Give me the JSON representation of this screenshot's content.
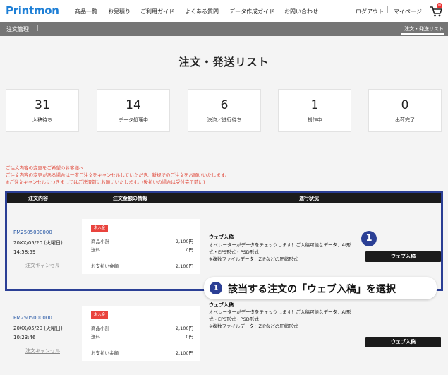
{
  "header": {
    "logo": "Printmon",
    "nav": [
      "商品一覧",
      "お見積り",
      "ご利用ガイド",
      "よくある質問",
      "データ作成ガイド",
      "お問い合わせ"
    ],
    "logout": "ログアウト",
    "mypage": "マイページ",
    "cart_count": "0"
  },
  "subbar": {
    "left": "注文管理",
    "right": "注文・発送リスト"
  },
  "page_title": "注文・発送リスト",
  "stats": [
    {
      "num": "31",
      "label": "入稿待ち"
    },
    {
      "num": "14",
      "label": "データ処理中"
    },
    {
      "num": "6",
      "label": "決済／進行待ち"
    },
    {
      "num": "1",
      "label": "制作中"
    },
    {
      "num": "0",
      "label": "出荷完了"
    }
  ],
  "notice": [
    "ご注文内容の変更をご希望のお客様へ",
    "ご注文内容の変更がある場合は一度ご注文をキャンセルしていただき、新規でのご注文をお願いいたします。",
    "※ご注文キャンセルにつきましてはご決済前にお願いいたします。(後払いの場合は受付完了前に)"
  ],
  "table_headers": [
    "注文内容",
    "注文金額の情報",
    "進行状況"
  ],
  "orders": [
    {
      "id": "PM2505000000",
      "date": "20XX/05/20 (火曜日)",
      "time": "14:58:59",
      "cancel": "注文キャンセル",
      "badge": "未入金",
      "subtotal_label": "商品小計",
      "subtotal": "2,100円",
      "shipping_label": "送料",
      "shipping": "0円",
      "total_label": "お支払い金額",
      "total": "2,100円",
      "status_title": "ウェブ入稿",
      "status_text": "オペレーターがデータをチェックします！ご入稿可能なデータ：AI形式・EPS形式・PSD形式",
      "status_note": "※複数ファイルデータ：ZIPなどの圧縮形式",
      "button": "ウェブ入稿"
    },
    {
      "id": "PM2505000000",
      "date": "20XX/05/20 (火曜日)",
      "time": "10:23:46",
      "cancel": "注文キャンセル",
      "badge": "未入金",
      "subtotal_label": "商品小計",
      "subtotal": "2,100円",
      "shipping_label": "送料",
      "shipping": "0円",
      "total_label": "お支払い金額",
      "total": "2,100円",
      "status_title": "ウェブ入稿",
      "status_text": "オペレーターがデータをチェックします！ご入稿可能なデータ：AI形式・EPS形式・PSD形式",
      "status_note": "※複数ファイルデータ：ZIPなどの圧縮形式",
      "button": "ウェブ入稿"
    }
  ],
  "annotation": {
    "step": "1",
    "text": "該当する注文の「ウェブ入稿」を選択"
  },
  "colors": {
    "brand": "#1e7fd6",
    "highlight": "#2b3f95",
    "notice": "#e0483a",
    "badge": "#e9433d"
  }
}
